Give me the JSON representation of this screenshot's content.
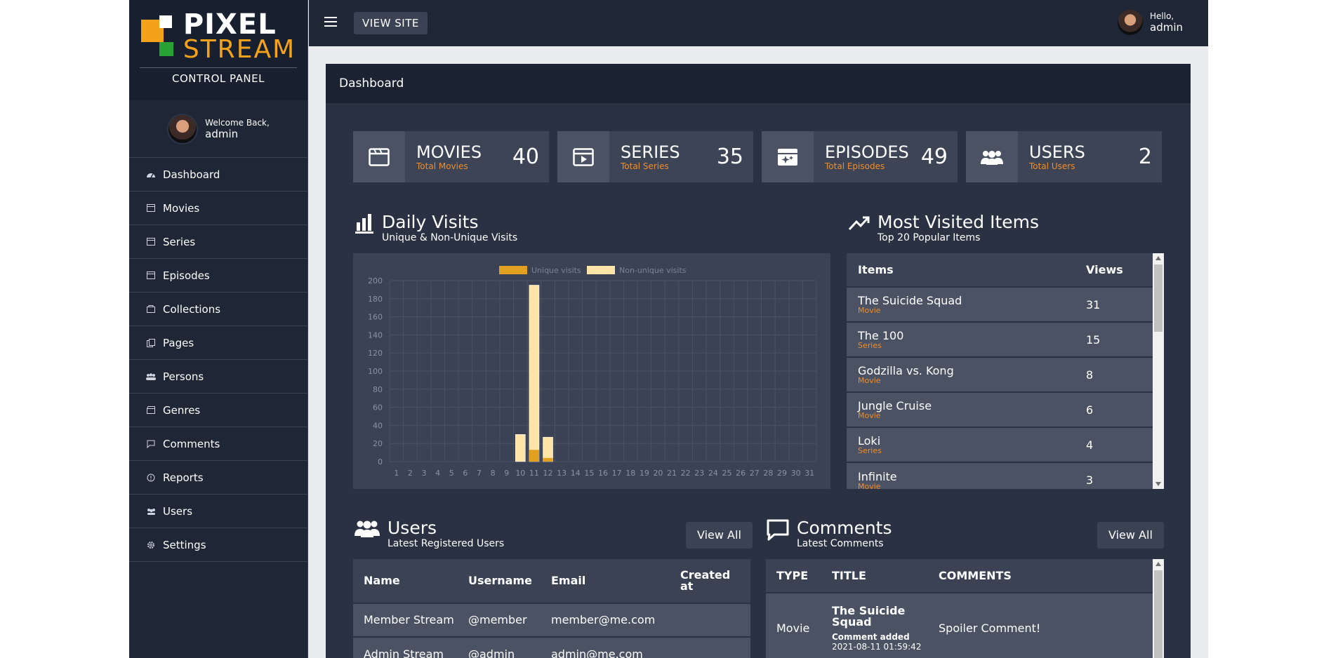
{
  "sidebar": {
    "brand_top": "PIXEL",
    "brand_bottom": "STREAM",
    "subtitle": "CONTROL PANEL",
    "welcome_line1": "Welcome Back,",
    "welcome_line2": "admin",
    "items": [
      {
        "label": "Dashboard",
        "icon": "dashboard-icon"
      },
      {
        "label": "Movies",
        "icon": "film-icon"
      },
      {
        "label": "Series",
        "icon": "film-icon"
      },
      {
        "label": "Episodes",
        "icon": "film-icon"
      },
      {
        "label": "Collections",
        "icon": "folder-icon"
      },
      {
        "label": "Pages",
        "icon": "pages-icon"
      },
      {
        "label": "Persons",
        "icon": "persons-icon"
      },
      {
        "label": "Genres",
        "icon": "clapper-icon"
      },
      {
        "label": "Comments",
        "icon": "comment-icon"
      },
      {
        "label": "Reports",
        "icon": "alert-icon"
      },
      {
        "label": "Users",
        "icon": "users-icon"
      },
      {
        "label": "Settings",
        "icon": "gear-icon"
      }
    ]
  },
  "topbar": {
    "view_site": "VIEW SITE",
    "hello": "Hello,",
    "user": "admin"
  },
  "panel": {
    "title": "Dashboard"
  },
  "stats": [
    {
      "title": "MOVIES",
      "sub": "Total Movies",
      "value": "40",
      "icon": "film-icon"
    },
    {
      "title": "SERIES",
      "sub": "Total Series",
      "value": "35",
      "icon": "play-icon"
    },
    {
      "title": "EPISODES",
      "sub": "Total Episodes",
      "value": "49",
      "icon": "sparkle-film-icon"
    },
    {
      "title": "USERS",
      "sub": "Total Users",
      "value": "2",
      "icon": "users-icon"
    }
  ],
  "daily": {
    "title": "Daily Visits",
    "subtitle": "Unique & Non-Unique Visits"
  },
  "chart_data": {
    "type": "bar",
    "categories": [
      "1",
      "2",
      "3",
      "4",
      "5",
      "6",
      "7",
      "8",
      "9",
      "10",
      "11",
      "12",
      "13",
      "14",
      "15",
      "16",
      "17",
      "18",
      "19",
      "20",
      "21",
      "22",
      "23",
      "24",
      "25",
      "26",
      "27",
      "28",
      "29",
      "30",
      "31"
    ],
    "series": [
      {
        "name": "Unique visits",
        "values": [
          0,
          0,
          0,
          0,
          0,
          0,
          0,
          0,
          0,
          0,
          13,
          4,
          0,
          0,
          0,
          0,
          0,
          0,
          0,
          0,
          0,
          0,
          0,
          0,
          0,
          0,
          0,
          0,
          0,
          0,
          0
        ]
      },
      {
        "name": "Non-unique visits",
        "values": [
          0,
          0,
          0,
          0,
          0,
          0,
          0,
          0,
          0,
          30,
          195,
          27,
          0,
          0,
          0,
          0,
          0,
          0,
          0,
          0,
          0,
          0,
          0,
          0,
          0,
          0,
          0,
          0,
          0,
          0,
          0
        ]
      }
    ],
    "yticks": [
      "0",
      "20",
      "40",
      "60",
      "80",
      "100",
      "120",
      "140",
      "160",
      "180",
      "200"
    ],
    "ylim": [
      0,
      200
    ],
    "colors": {
      "unique": "#e2a020",
      "nonunique": "#ffe4a8"
    },
    "legend": "top-center",
    "grid": true
  },
  "most_visited": {
    "title": "Most Visited Items",
    "subtitle": "Top 20 Popular Items",
    "col_items": "Items",
    "col_views": "Views",
    "rows": [
      {
        "name": "The Suicide Squad",
        "type": "Movie",
        "views": "31"
      },
      {
        "name": "The 100",
        "type": "Series",
        "views": "15"
      },
      {
        "name": "Godzilla vs. Kong",
        "type": "Movie",
        "views": "8"
      },
      {
        "name": "Jungle Cruise",
        "type": "Movie",
        "views": "6"
      },
      {
        "name": "Loki",
        "type": "Series",
        "views": "4"
      },
      {
        "name": "Infinite",
        "type": "Movie",
        "views": "3"
      }
    ]
  },
  "users": {
    "title": "Users",
    "subtitle": "Latest Registered Users",
    "view_all": "View All",
    "cols": [
      "Name",
      "Username",
      "Email",
      "Created at"
    ],
    "rows": [
      {
        "name": "Member Stream",
        "username": "@member",
        "email": "member@me.com",
        "created": ""
      },
      {
        "name": "Admin Stream",
        "username": "@admin",
        "email": "admin@me.com",
        "created": ""
      }
    ]
  },
  "comments": {
    "title": "Comments",
    "subtitle": "Latest Comments",
    "view_all": "View All",
    "cols": [
      "TYPE",
      "TITLE",
      "COMMENTS"
    ],
    "rows": [
      {
        "type": "Movie",
        "title": "The Suicide Squad",
        "meta": "Comment added",
        "date": "2021-08-11 01:59:42",
        "comment": "Spoiler Comment!"
      }
    ]
  }
}
